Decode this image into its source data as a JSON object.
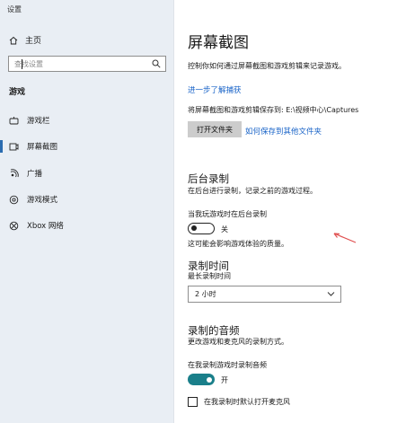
{
  "window": {
    "title": "设置"
  },
  "sidebar": {
    "home_label": "主页",
    "search_placeholder": "查找设置",
    "section_label": "游戏",
    "items": [
      {
        "label": "游戏栏",
        "icon": "game-bar-icon"
      },
      {
        "label": "屏幕截图",
        "icon": "capture-icon",
        "selected": true
      },
      {
        "label": "广播",
        "icon": "broadcast-icon"
      },
      {
        "label": "游戏模式",
        "icon": "game-mode-icon"
      },
      {
        "label": "Xbox 网络",
        "icon": "xbox-icon"
      }
    ]
  },
  "main": {
    "title": "屏幕截图",
    "description": "控制你如何通过屏幕截图和游戏剪辑来记录游戏。",
    "learn_more_link": "进一步了解捕获",
    "save_path_text": "将屏幕截图和游戏剪辑保存到: E:\\视频中心\\Captures",
    "open_folder_button": "打开文件夹",
    "other_folder_link": "如何保存到其他文件夹",
    "background_recording": {
      "heading": "后台录制",
      "subtext": "在后台进行录制，记录之前的游戏过程。",
      "toggle_label": "当我玩游戏时在后台录制",
      "toggle_state": "关",
      "toggle_on": false,
      "note": "这可能会影响游戏体验的质量。"
    },
    "recording_time": {
      "heading": "录制时间",
      "sublabel": "最长录制时间",
      "selected": "2 小时"
    },
    "recorded_audio": {
      "heading": "录制的音频",
      "subtext": "更改游戏和麦克风的录制方式。",
      "toggle_label": "在我录制游戏时录制音频",
      "toggle_state": "开",
      "toggle_on": true,
      "checkbox_label": "在我录制时默认打开麦克风"
    }
  },
  "colors": {
    "sidebar_bg": "#e9eef4",
    "accent": "#1a64c8",
    "toggle_on": "#1a7f8a",
    "annotation_arrow": "#e05050"
  }
}
